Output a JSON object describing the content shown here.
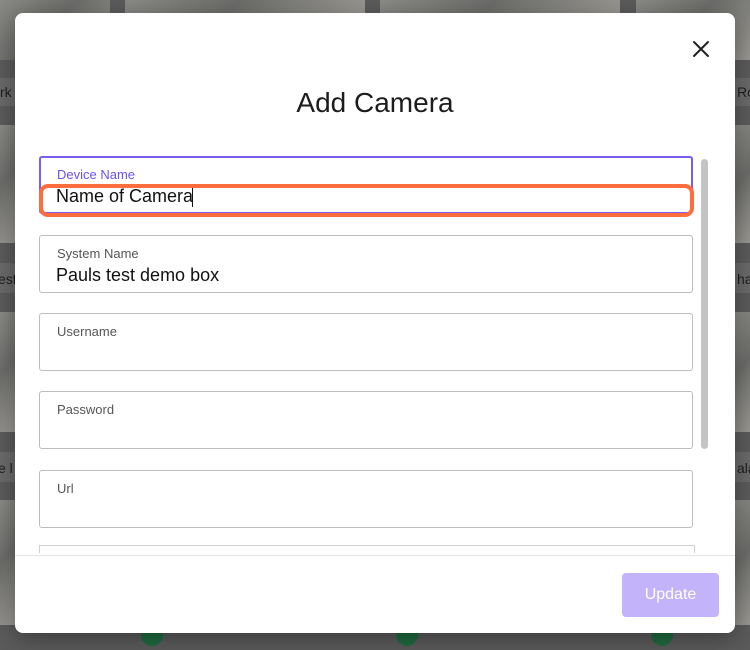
{
  "background": {
    "left_labels": [
      "rk",
      "est",
      "e l"
    ],
    "right_labels": [
      "Ro",
      "ha",
      "ala"
    ]
  },
  "modal": {
    "title": "Add Camera",
    "close_icon": "close-icon",
    "fields": {
      "device_name": {
        "label": "Device Name",
        "value": "Name of Camera"
      },
      "system_name": {
        "label": "System Name",
        "value": "Pauls test demo box"
      },
      "username": {
        "label": "Username",
        "value": ""
      },
      "password": {
        "label": "Password",
        "value": ""
      },
      "url": {
        "label": "Url",
        "value": ""
      }
    },
    "footer": {
      "update_label": "Update"
    }
  },
  "colors": {
    "accent": "#7b5cf0",
    "button_disabled": "#c2b3fb",
    "highlight": "#ff6d3f"
  }
}
